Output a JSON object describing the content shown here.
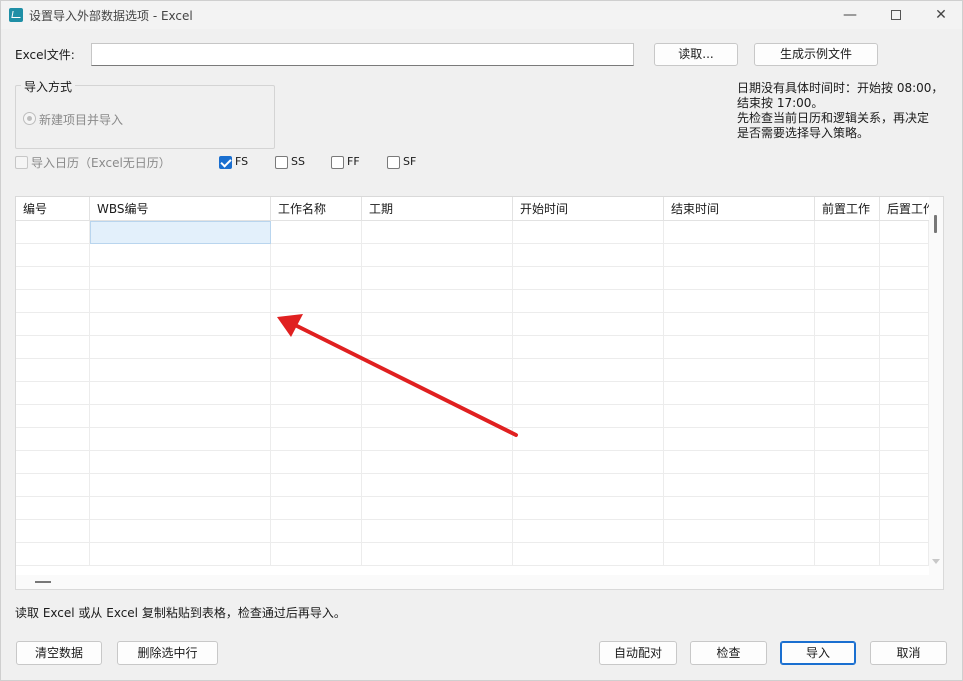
{
  "window": {
    "title": "设置导入外部数据选项 - Excel",
    "minimize_icon": "minimize-icon",
    "maximize_icon": "maximize-icon",
    "close_icon": "close-icon",
    "app_icon": "excel-import-app-icon"
  },
  "file": {
    "label": "Excel文件:",
    "value": "",
    "read_button": "读取...",
    "sample_button": "生成示例文件"
  },
  "import_mode": {
    "group_title": "导入方式",
    "option_label": "新建项目并导入",
    "option_selected": true,
    "option_enabled": false
  },
  "info_text": {
    "line1": "日期没有具体时间时：开始按 08:00，",
    "line2": "结束按 17:00。",
    "line3": "先检查当前日历和逻辑关系，再决定",
    "line4": "是否需要选择导入策略。"
  },
  "options": {
    "import_calendar": {
      "label": "导入日历（Excel无日历）",
      "checked": false,
      "enabled": false
    },
    "fs": {
      "label": "FS",
      "checked": true
    },
    "ss": {
      "label": "SS",
      "checked": false
    },
    "ff": {
      "label": "FF",
      "checked": false
    },
    "sf": {
      "label": "SF",
      "checked": false
    }
  },
  "table": {
    "columns": [
      "编号",
      "WBS编号",
      "工作名称",
      "工期",
      "开始时间",
      "结束时间",
      "前置工作",
      "后置工作"
    ],
    "rows": [
      [
        "",
        "",
        "",
        "",
        "",
        "",
        "",
        ""
      ],
      [
        "",
        "",
        "",
        "",
        "",
        "",
        "",
        ""
      ],
      [
        "",
        "",
        "",
        "",
        "",
        "",
        "",
        ""
      ],
      [
        "",
        "",
        "",
        "",
        "",
        "",
        "",
        ""
      ],
      [
        "",
        "",
        "",
        "",
        "",
        "",
        "",
        ""
      ],
      [
        "",
        "",
        "",
        "",
        "",
        "",
        "",
        ""
      ],
      [
        "",
        "",
        "",
        "",
        "",
        "",
        "",
        ""
      ],
      [
        "",
        "",
        "",
        "",
        "",
        "",
        "",
        ""
      ],
      [
        "",
        "",
        "",
        "",
        "",
        "",
        "",
        ""
      ],
      [
        "",
        "",
        "",
        "",
        "",
        "",
        "",
        ""
      ],
      [
        "",
        "",
        "",
        "",
        "",
        "",
        "",
        ""
      ],
      [
        "",
        "",
        "",
        "",
        "",
        "",
        "",
        ""
      ],
      [
        "",
        "",
        "",
        "",
        "",
        "",
        "",
        ""
      ],
      [
        "",
        "",
        "",
        "",
        "",
        "",
        "",
        ""
      ],
      [
        "",
        "",
        "",
        "",
        "",
        "",
        "",
        ""
      ]
    ],
    "selected_cell": {
      "row": 0,
      "column": "WBS编号"
    }
  },
  "hint": "读取 Excel 或从 Excel 复制粘贴到表格，检查通过后再导入。",
  "buttons": {
    "clear": "清空数据",
    "delete_row": "删除选中行",
    "auto_match": "自动配对",
    "check": "检查",
    "import": "导入",
    "cancel": "取消"
  },
  "annotation": {
    "arrow_icon": "red-arrow-annotation",
    "color": "#e02020"
  }
}
